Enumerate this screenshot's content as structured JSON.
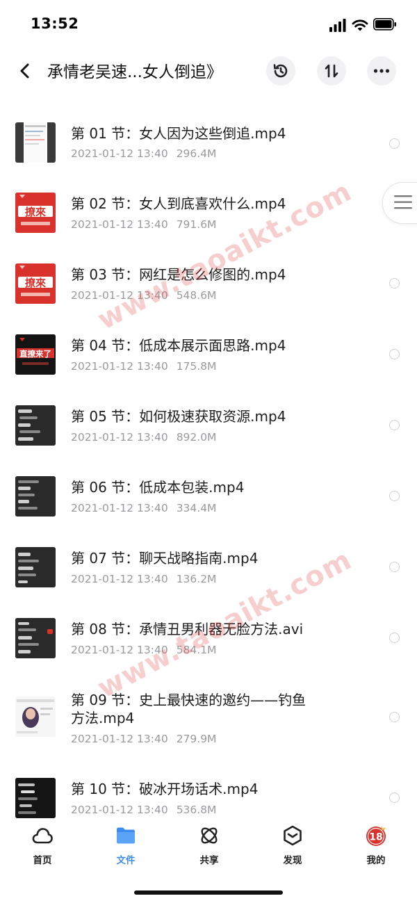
{
  "status": {
    "time": "13:52"
  },
  "nav": {
    "title": "承情老吴速...女人倒追》"
  },
  "files": [
    {
      "name": "第 01 节：女人因为这些倒追.mp4",
      "date": "2021-01-12 13:40",
      "size": "296.4M",
      "thumb": "doc"
    },
    {
      "name": "第 02 节：女人到底喜欢什么.mp4",
      "date": "2021-01-12 13:40",
      "size": "791.6M",
      "thumb": "red",
      "thumb_text": "撩來"
    },
    {
      "name": "第 03 节：网红是怎么修图的.mp4",
      "date": "2021-01-12 13:40",
      "size": "548.6M",
      "thumb": "red",
      "thumb_text": "撩來"
    },
    {
      "name": "第 04 节：低成本展示面思路.mp4",
      "date": "2021-01-12 13:40",
      "size": "175.8M",
      "thumb": "black",
      "thumb_text": "直撩来了"
    },
    {
      "name": "第 05 节：如何极速获取资源.mp4",
      "date": "2021-01-12 13:40",
      "size": "892.0M",
      "thumb": "chat"
    },
    {
      "name": "第 06 节：低成本包装.mp4",
      "date": "2021-01-12 13:40",
      "size": "334.4M",
      "thumb": "chat"
    },
    {
      "name": "第 07 节：聊天战略指南.mp4",
      "date": "2021-01-12 13:40",
      "size": "136.2M",
      "thumb": "chat"
    },
    {
      "name": "第 08 节：承情丑男利器无脸方法.avi",
      "date": "2021-01-12 13:40",
      "size": "584.1M",
      "thumb": "chat"
    },
    {
      "name": "第 09 节：史上最快速的邀约——钓鱼",
      "name_line2": "方法.mp4",
      "date": "2021-01-12 13:40",
      "size": "279.9M",
      "thumb": "photo"
    },
    {
      "name": "第 10 节：破冰开场话术.mp4",
      "date": "2021-01-12 13:40",
      "size": "536.8M",
      "thumb": "chatdark"
    }
  ],
  "watermarks": [
    "www.taoaikt.com",
    "www.taoaikt.com"
  ],
  "tabs": [
    {
      "label": "首页",
      "icon": "cloud-icon",
      "active": false
    },
    {
      "label": "文件",
      "icon": "folder-icon",
      "active": true
    },
    {
      "label": "共享",
      "icon": "share-orbit-icon",
      "active": false
    },
    {
      "label": "发现",
      "icon": "discover-icon",
      "active": false
    },
    {
      "label": "我的",
      "icon": "avatar-18-icon",
      "active": false,
      "avatar_text": "18"
    }
  ],
  "colors": {
    "accent": "#3c8cf0",
    "thumb_red": "#d9312b",
    "watermark": "#e13c3c"
  }
}
